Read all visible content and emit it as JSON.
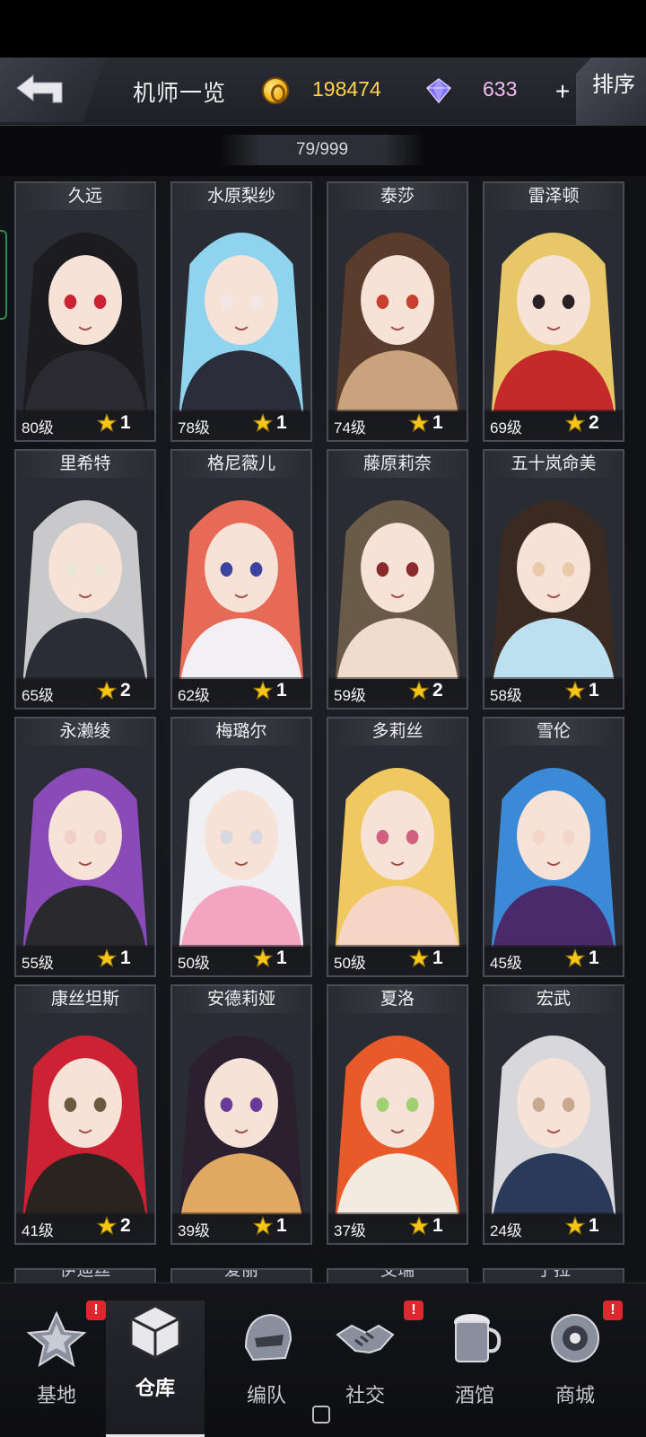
{
  "header": {
    "title": "机师一览",
    "coins": "198474",
    "gems": "633",
    "plus_label": "+",
    "sort_label": "排序",
    "count": "79/999"
  },
  "colors": {
    "coin": "#ffd34a",
    "gem": "#f6bdf5",
    "badge": "#e0262e",
    "star": "#f5c518"
  },
  "pilots": [
    {
      "name": "久远",
      "level": "80级",
      "stars": "1"
    },
    {
      "name": "水原梨纱",
      "level": "78级",
      "stars": "1"
    },
    {
      "name": "泰莎",
      "level": "74级",
      "stars": "1"
    },
    {
      "name": "雷泽顿",
      "level": "69级",
      "stars": "2"
    },
    {
      "name": "里希特",
      "level": "65级",
      "stars": "2"
    },
    {
      "name": "格尼薇儿",
      "level": "62级",
      "stars": "1"
    },
    {
      "name": "藤原莉奈",
      "level": "59级",
      "stars": "2"
    },
    {
      "name": "五十岚命美",
      "level": "58级",
      "stars": "1"
    },
    {
      "name": "永濑绫",
      "level": "55级",
      "stars": "1"
    },
    {
      "name": "梅璐尔",
      "level": "50级",
      "stars": "1"
    },
    {
      "name": "多莉丝",
      "level": "50级",
      "stars": "1"
    },
    {
      "name": "雪伦",
      "level": "45级",
      "stars": "1"
    },
    {
      "name": "康丝坦斯",
      "level": "41级",
      "stars": "2"
    },
    {
      "name": "安德莉娅",
      "level": "39级",
      "stars": "1"
    },
    {
      "name": "夏洛",
      "level": "37级",
      "stars": "1"
    },
    {
      "name": "宏武",
      "level": "24级",
      "stars": "1"
    }
  ],
  "partial_row": [
    "伊迪丝",
    "爱丽",
    "艾瑞",
    "宁拉"
  ],
  "nav": {
    "items": [
      {
        "label": "基地",
        "icon": "base-star-icon",
        "badge": "!"
      },
      {
        "label": "仓库",
        "icon": "warehouse-cube-icon",
        "badge": ""
      },
      {
        "label": "编队",
        "icon": "formation-helmet-icon",
        "badge": ""
      },
      {
        "label": "社交",
        "icon": "social-handshake-icon",
        "badge": "!"
      },
      {
        "label": "酒馆",
        "icon": "tavern-mug-icon",
        "badge": ""
      },
      {
        "label": "商城",
        "icon": "shop-robot-icon",
        "badge": "!"
      }
    ]
  }
}
